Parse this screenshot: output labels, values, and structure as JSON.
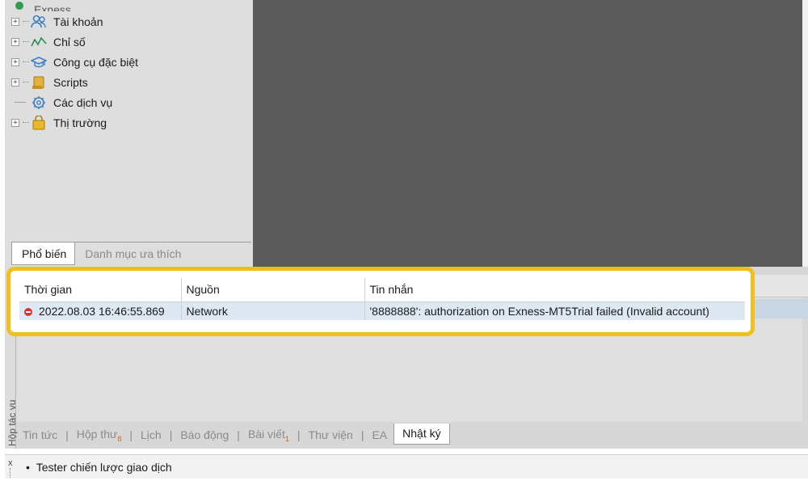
{
  "navigator": {
    "root_label": "Exness",
    "items": [
      {
        "label": "Tài khoản",
        "icon": "accounts-icon",
        "expandable": true
      },
      {
        "label": "Chỉ số",
        "icon": "indicators-icon",
        "expandable": true
      },
      {
        "label": "Công cụ đặc biệt",
        "icon": "expert-advisors-icon",
        "expandable": true
      },
      {
        "label": "Scripts",
        "icon": "scripts-icon",
        "expandable": true
      },
      {
        "label": "Các dịch vụ",
        "icon": "services-icon",
        "expandable": false
      },
      {
        "label": "Thị trường",
        "icon": "market-icon",
        "expandable": true
      }
    ],
    "tabs": [
      {
        "label": "Phổ biến",
        "active": true
      },
      {
        "label": "Danh mục ưa thích",
        "active": false
      }
    ]
  },
  "journal": {
    "columns": [
      "Thời gian",
      "Nguồn",
      "Tin nhắn"
    ],
    "rows": [
      {
        "time": "2022.08.03 16:46:55.869",
        "source": "Network",
        "message": "'8888888': authorization on Exness-MT5Trial failed (Invalid account)",
        "level": "error"
      }
    ]
  },
  "toolbox": {
    "side_label": "Hộp tác vụ",
    "tabs": [
      {
        "label": "Tin tức",
        "badge": ""
      },
      {
        "label": "Hộp thư",
        "badge": "8"
      },
      {
        "label": "Lịch",
        "badge": ""
      },
      {
        "label": "Báo động",
        "badge": ""
      },
      {
        "label": "Bài viết",
        "badge": "1"
      },
      {
        "label": "Thư viện",
        "badge": ""
      },
      {
        "label": "EA",
        "badge": ""
      },
      {
        "label": "Nhật ký",
        "badge": "",
        "active": true
      }
    ]
  },
  "tester": {
    "label": "Tester chiến lược giao dịch",
    "close_glyph": "x"
  },
  "colors": {
    "highlight": "#f2bf1e",
    "chart_bg": "#5a5a5a",
    "selected_row": "#dde8f3",
    "error": "#d9342b"
  }
}
